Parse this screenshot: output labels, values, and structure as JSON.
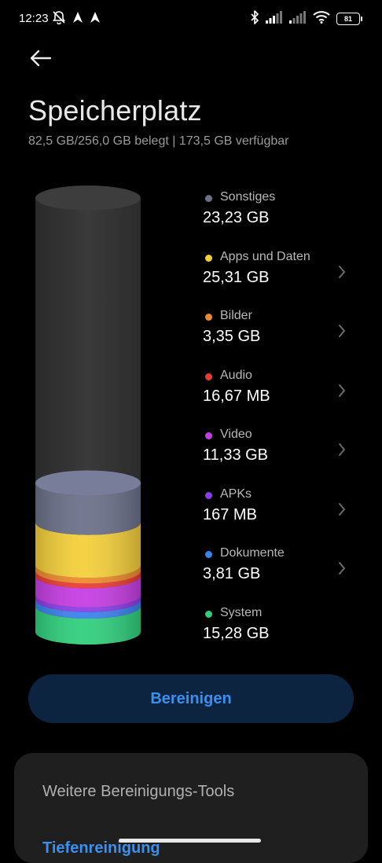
{
  "status_bar": {
    "time": "12:23",
    "battery": "81",
    "icons_left": [
      "muted-notification-icon",
      "navigation-arrow-icon",
      "navigation-arrow-icon"
    ],
    "icons_right": [
      "bluetooth-icon",
      "signal-icon",
      "signal-icon",
      "wifi-icon",
      "battery-icon"
    ]
  },
  "header": {
    "title": "Speicherplatz",
    "subtitle": "82,5 GB/256,0 GB belegt | 173,5 GB verfügbar"
  },
  "storage": {
    "total_gb": 256.0,
    "used_gb": 82.5,
    "categories": [
      {
        "label": "Sonstiges",
        "value": "23,23 GB",
        "gb": 23.23,
        "color": "#6b7089",
        "has_chevron": false
      },
      {
        "label": "Apps und Daten",
        "value": "25,31 GB",
        "gb": 25.31,
        "color": "#f4cf3a",
        "has_chevron": true
      },
      {
        "label": "Bilder",
        "value": "3,35 GB",
        "gb": 3.35,
        "color": "#f0892d",
        "has_chevron": true
      },
      {
        "label": "Audio",
        "value": "16,67 MB",
        "gb": 0.0167,
        "color": "#eb3b35",
        "has_chevron": true
      },
      {
        "label": "Video",
        "value": "11,33 GB",
        "gb": 11.33,
        "color": "#c63de4",
        "has_chevron": true
      },
      {
        "label": "APKs",
        "value": "167 MB",
        "gb": 0.167,
        "color": "#8a3ee8",
        "has_chevron": true
      },
      {
        "label": "Dokumente",
        "value": "3,81 GB",
        "gb": 3.81,
        "color": "#3a82ee",
        "has_chevron": true
      },
      {
        "label": "System",
        "value": "15,28 GB",
        "gb": 15.28,
        "color": "#2fcf7c",
        "has_chevron": false
      }
    ]
  },
  "actions": {
    "clean_label": "Bereinigen"
  },
  "tools": {
    "title": "Weitere Bereinigungs-Tools",
    "link": "Tiefenreinigung"
  }
}
